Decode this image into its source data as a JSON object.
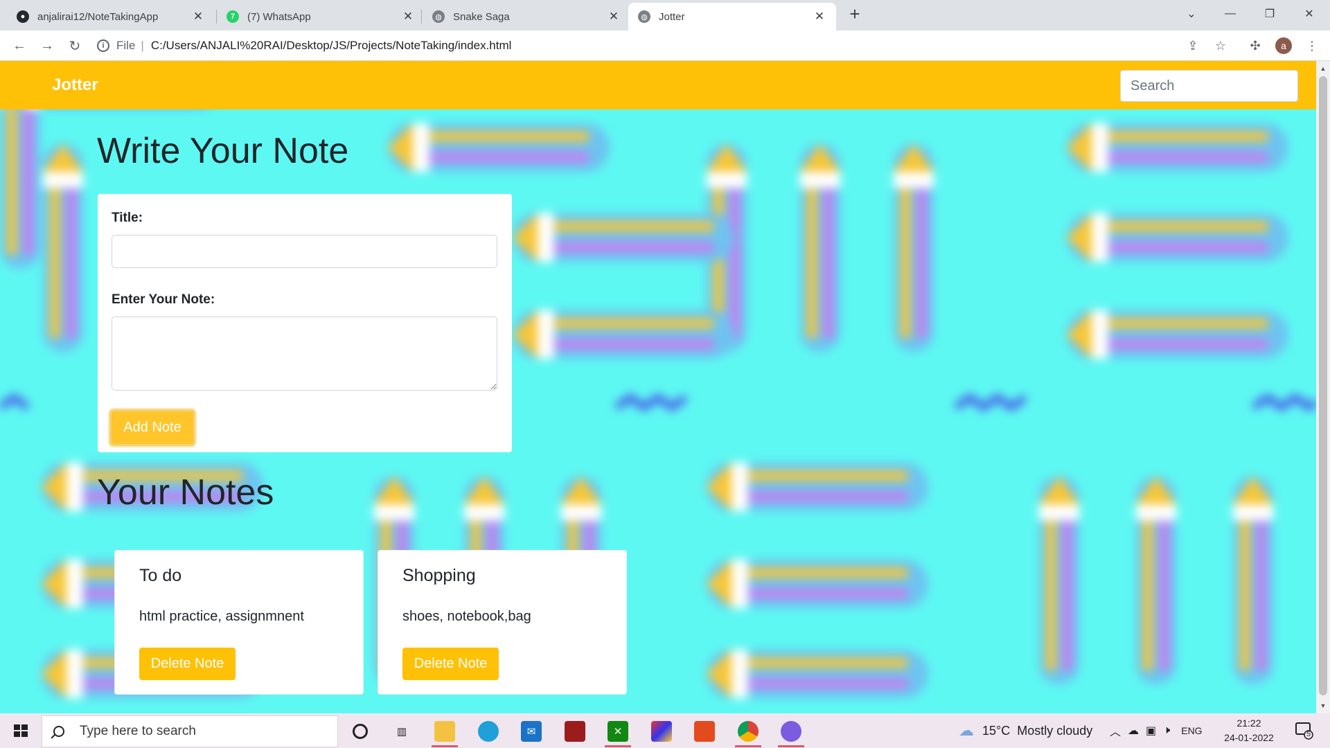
{
  "browser": {
    "tabs": [
      {
        "title": "anjalirai12/NoteTakingApp",
        "icon": "github-icon",
        "active": false
      },
      {
        "title": "(7) WhatsApp",
        "icon": "whatsapp-icon",
        "active": false
      },
      {
        "title": "Snake Saga",
        "icon": "globe-icon",
        "active": false
      },
      {
        "title": "Jotter",
        "icon": "globe-icon",
        "active": true
      }
    ],
    "address": {
      "scheme": "File",
      "url": "C:/Users/ANJALI%20RAI/Desktop/JS/Projects/NoteTaking/index.html"
    },
    "profile_initial": "a"
  },
  "page": {
    "brand": "Jotter",
    "search_placeholder": "Search",
    "write_heading": "Write Your Note",
    "form": {
      "title_label": "Title:",
      "title_value": "",
      "note_label": "Enter Your Note:",
      "note_value": "",
      "add_button": "Add Note"
    },
    "notes_heading": "Your Notes",
    "notes": [
      {
        "title": "To do",
        "text": "html practice, assignmnent",
        "button": "Delete Note"
      },
      {
        "title": "Shopping",
        "text": "shoes, notebook,bag",
        "button": "Delete Note"
      }
    ],
    "colors": {
      "accent": "#ffc107",
      "background": "#5ef8f3"
    }
  },
  "taskbar": {
    "search_placeholder": "Type here to search",
    "weather": {
      "temp": "15°C",
      "condition": "Mostly cloudy"
    },
    "language": "ENG",
    "time": "21:22",
    "date": "24-01-2022",
    "notification_count": "5",
    "apps": [
      "cortana-icon",
      "task-view-icon",
      "file-explorer-icon",
      "edge-icon",
      "mail-icon",
      "game-icon",
      "xbox-icon",
      "paint3d-icon",
      "office-icon",
      "chrome-icon",
      "chrome-profile-icon"
    ]
  }
}
